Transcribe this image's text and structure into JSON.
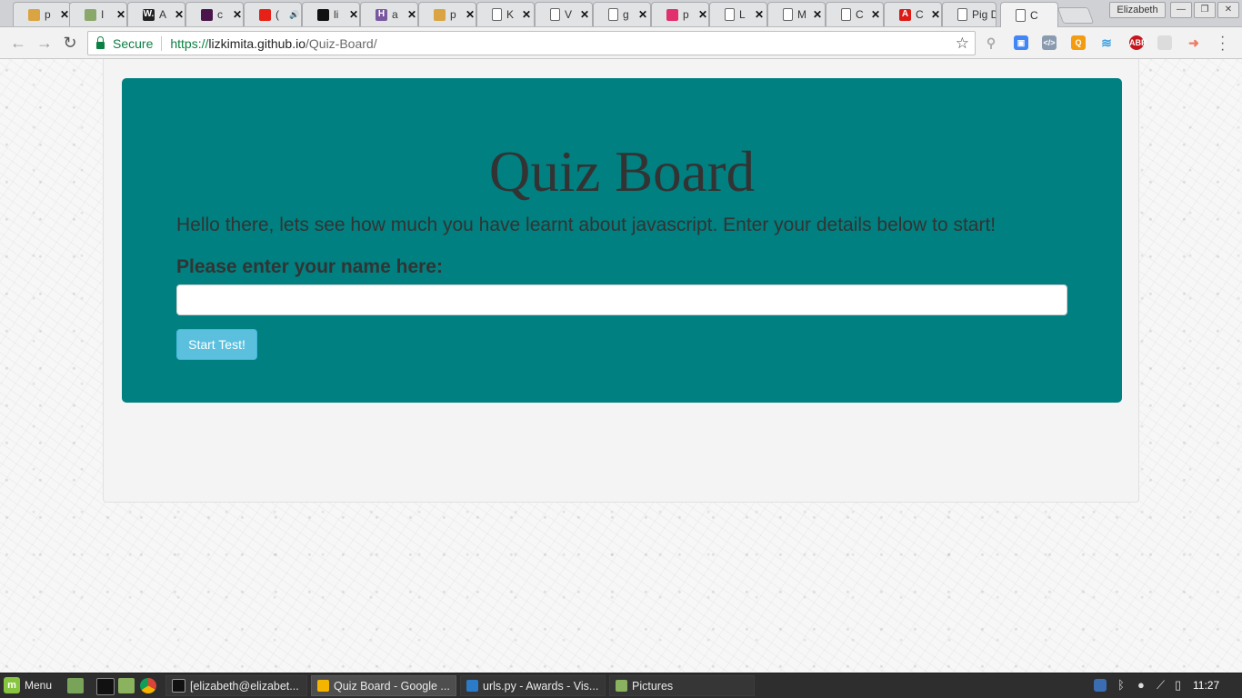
{
  "browser": {
    "tabs": [
      {
        "title": "p",
        "icon": "pin-person-favicon",
        "color": "#d9a441"
      },
      {
        "title": "I",
        "icon": "tree-favicon",
        "color": "#8ba86b"
      },
      {
        "title": "A",
        "icon": "w-favicon",
        "color": "#222222",
        "glyph": "W."
      },
      {
        "title": "c",
        "icon": "slack-favicon",
        "color": "#4a154b"
      },
      {
        "title": "(",
        "icon": "youtube-favicon",
        "color": "#e62117",
        "audio": true
      },
      {
        "title": "li",
        "icon": "github-favicon",
        "color": "#111111"
      },
      {
        "title": "a",
        "icon": "heroku-favicon",
        "color": "#79589f",
        "glyph": "H"
      },
      {
        "title": "p",
        "icon": "pin-person-favicon",
        "color": "#d9a441"
      },
      {
        "title": "K",
        "icon": "page-favicon",
        "color": "#ffffff"
      },
      {
        "title": "V",
        "icon": "page-favicon",
        "color": "#ffffff"
      },
      {
        "title": "g",
        "icon": "page-favicon",
        "color": "#ffffff"
      },
      {
        "title": "p",
        "icon": "instagram-favicon",
        "color": "#e1306c"
      },
      {
        "title": "L",
        "icon": "page-favicon",
        "color": "#ffffff"
      },
      {
        "title": "M",
        "icon": "page-favicon",
        "color": "#ffffff"
      },
      {
        "title": "C",
        "icon": "page-favicon",
        "color": "#ffffff"
      },
      {
        "title": "C",
        "icon": "angular-favicon",
        "color": "#dd1b16",
        "glyph": "A"
      },
      {
        "title": "Pig D",
        "icon": "page-favicon",
        "color": "#ffffff"
      },
      {
        "title": "C",
        "icon": "page-favicon",
        "color": "#ffffff",
        "active": true
      }
    ],
    "profile_name": "Elizabeth",
    "address": {
      "secure_label": "Secure",
      "scheme": "https://",
      "host": "lizkimita.github.io",
      "path": "/Quiz-Board/"
    }
  },
  "page": {
    "title": "Quiz Board",
    "lead": "Hello there, lets see how much you have learnt about javascript. Enter your details below to start!",
    "name_label": "Please enter your name here:",
    "name_value": "",
    "start_button": "Start Test!",
    "colors": {
      "jumbotron": "#008080",
      "button": "#5bc0de"
    }
  },
  "taskbar": {
    "menu_label": "Menu",
    "tasks": [
      {
        "label": "[elizabeth@elizabet...",
        "icon": "terminal-icon"
      },
      {
        "label": "Quiz Board - Google ...",
        "icon": "chrome-icon",
        "active": true
      },
      {
        "label": "urls.py - Awards - Vis...",
        "icon": "vscode-icon"
      },
      {
        "label": "Pictures",
        "icon": "folder-icon"
      }
    ],
    "clock": "11:27"
  }
}
